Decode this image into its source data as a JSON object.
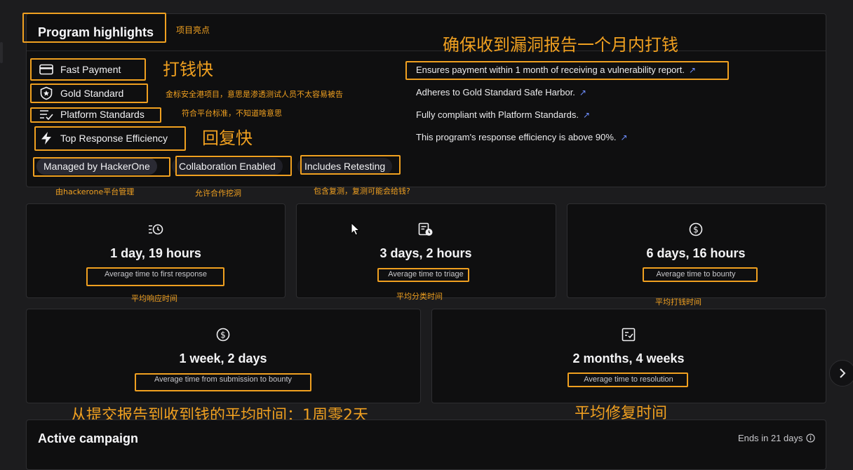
{
  "highlights": {
    "title": "Program highlights",
    "title_note": "项目亮点",
    "items": [
      {
        "label": "Fast Payment",
        "icon": "card-icon",
        "desc": "Ensures payment within 1 month of receiving a vulnerability report.",
        "note": "打钱快"
      },
      {
        "label": "Gold Standard",
        "icon": "shield-star-icon",
        "desc": "Adheres to Gold Standard Safe Harbor.",
        "note": "金标安全港项目，意思是渗透测试人员不太容易被告"
      },
      {
        "label": "Platform Standards",
        "icon": "list-check-icon",
        "desc": "Fully compliant with Platform Standards.",
        "note": "符合平台标准，不知道啥意思"
      },
      {
        "label": "Top Response Efficiency",
        "icon": "lightning-icon",
        "desc": "This program's response efficiency is above 90%.",
        "note": "回复快"
      }
    ],
    "desc_note": "确保收到漏洞报告一个月内打钱",
    "pills": [
      {
        "label": "Managed by HackerOne",
        "note": "由hackerone平台管理"
      },
      {
        "label": "Collaboration Enabled",
        "note": "允许合作挖洞"
      },
      {
        "label": "Includes Retesting",
        "note": "包含复测，复测可能会给钱?"
      }
    ]
  },
  "stats": [
    {
      "value": "1 day, 19 hours",
      "label": "Average time to first response",
      "note": "平均响应时间",
      "icon": "list-clock-icon"
    },
    {
      "value": "3 days, 2 hours",
      "label": "Average time to triage",
      "note": "平均分类时间",
      "icon": "doc-clock-icon"
    },
    {
      "value": "6 days, 16 hours",
      "label": "Average time to bounty",
      "note": "平均打钱时间",
      "icon": "dollar-icon"
    },
    {
      "value": "1 week, 2 days",
      "label": "Average time from submission to bounty",
      "note": "从提交报告到收到钱的平均时间：1周零2天",
      "icon": "dollar-icon"
    },
    {
      "value": "2 months, 4 weeks",
      "label": "Average time to resolution",
      "note": "平均修复时间",
      "icon": "checklist-icon"
    }
  ],
  "campaign": {
    "title": "Active campaign",
    "ends": "Ends in 21 days"
  },
  "colors": {
    "annotation": "#f0a020",
    "link": "#6f8fff"
  }
}
